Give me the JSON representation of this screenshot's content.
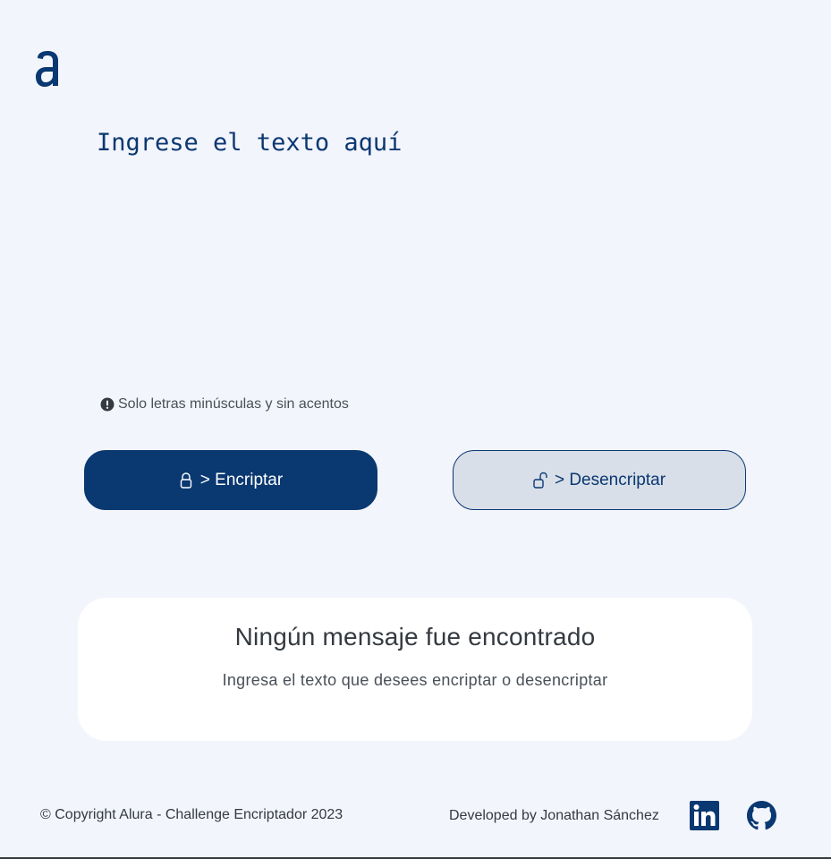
{
  "app": {
    "logo_icon": "alura-logo-icon",
    "accent_color": "#0a3871",
    "background_color": "#f3f5fc"
  },
  "editor": {
    "placeholder": "Ingrese el texto aquí",
    "value": ""
  },
  "hint": {
    "icon": "exclamation-circle-icon",
    "text": "Solo letras minúsculas y sin acentos"
  },
  "buttons": {
    "encrypt": {
      "icon": "lock-icon",
      "label": "> Encriptar"
    },
    "decrypt": {
      "icon": "unlock-icon",
      "label": "> Desencriptar"
    }
  },
  "output": {
    "title": "Ningún mensaje fue encontrado",
    "subtitle": "Ingresa el texto que desees encriptar o desencriptar"
  },
  "footer": {
    "copyright": "© Copyright Alura - Challenge Encriptador 2023",
    "developer": "Developed by Jonathan Sánchez",
    "links": [
      {
        "icon": "linkedin-icon"
      },
      {
        "icon": "github-icon"
      }
    ]
  }
}
